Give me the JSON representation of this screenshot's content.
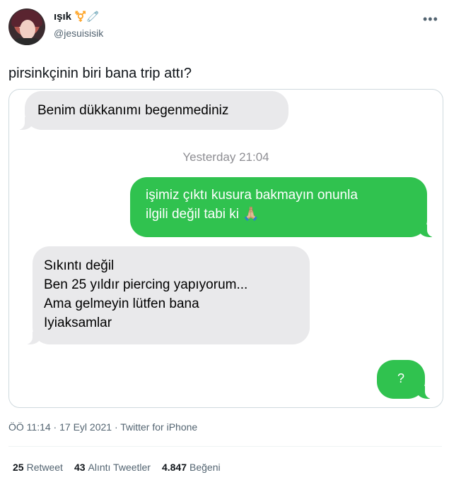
{
  "author": {
    "display_name": "ışık",
    "name_emojis": "⚧️🧷",
    "handle": "@jesuisisik",
    "more_icon": "more-icon"
  },
  "tweet": {
    "text": "pirsinkçinin biri bana trip attı?"
  },
  "conversation": {
    "msg1": "Benim dükkanımı begenmediniz",
    "timestamp": "Yesterday 21:04",
    "msg2_line1": "işimiz çıktı kusura bakmayın onunla",
    "msg2_line2": "ilgili değil tabi ki 🙏🏼",
    "msg3_line1": "Sıkıntı değil",
    "msg3_line2": "Ben 25 yıldır piercing yapıyorum...",
    "msg3_line3": "Ama gelmeyin lütfen bana",
    "msg3_line4": "Iyiaksamlar",
    "msg4": "?",
    "colors": {
      "incoming": "#e9e9eb",
      "outgoing": "#30c24f"
    }
  },
  "meta": {
    "text": "ÖÖ 11:14 · 17 Eyl 2021 · Twitter for iPhone"
  },
  "stats": {
    "retweets_count": "25",
    "retweets_label": "Retweet",
    "quotes_count": "43",
    "quotes_label": "Alıntı Tweetler",
    "likes_count": "4.847",
    "likes_label": "Beğeni"
  }
}
